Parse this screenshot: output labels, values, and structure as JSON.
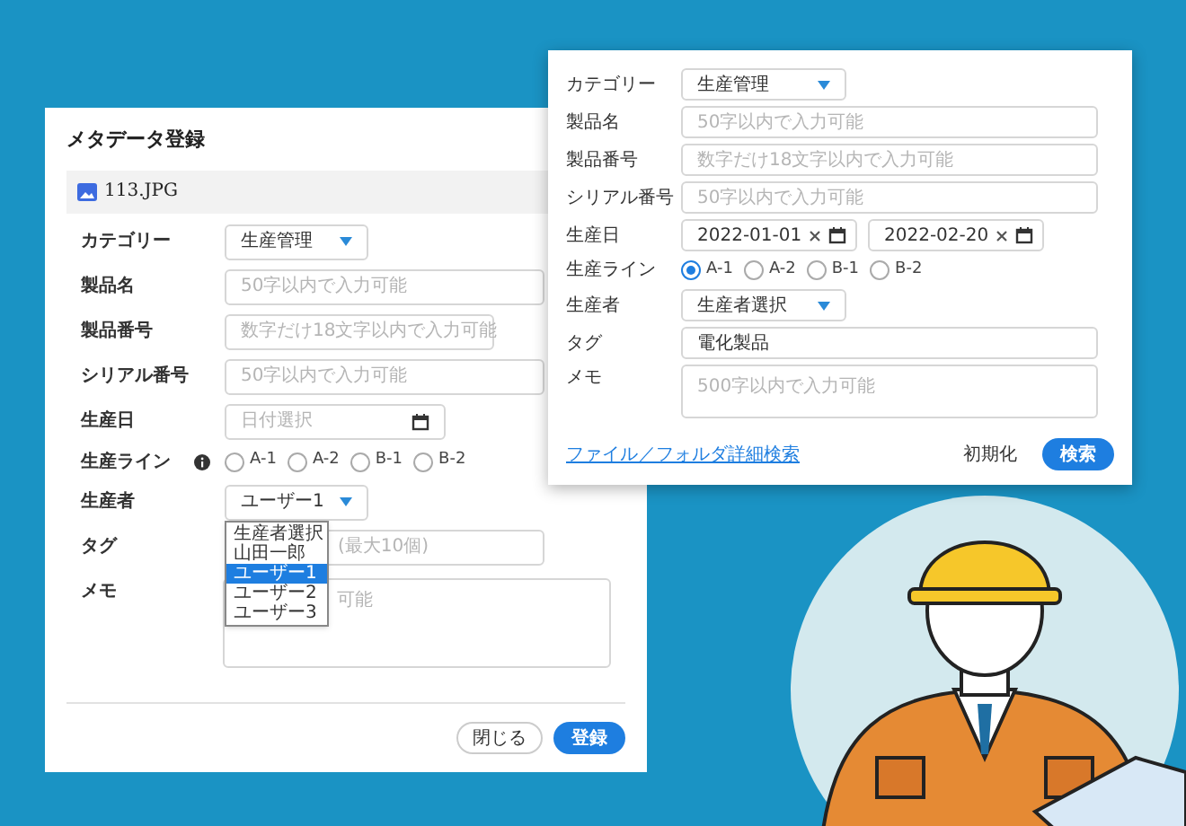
{
  "registration_dialog": {
    "title": "メタデータ登録",
    "file": "113.JPG",
    "fields": [
      {
        "kind": "select",
        "label": "カテゴリー",
        "value": "生産管理"
      },
      {
        "kind": "text",
        "label": "製品名",
        "placeholder": "50字以内で入力可能",
        "wide": true
      },
      {
        "kind": "text",
        "label": "製品番号",
        "placeholder": "数字だけ18文字以内で入力可能",
        "wide": false
      },
      {
        "kind": "text",
        "label": "シリアル番号",
        "placeholder": "50字以内で入力可能",
        "wide": true
      },
      {
        "kind": "date",
        "label": "生産日",
        "placeholder": "日付選択"
      },
      {
        "kind": "radio",
        "label": "生産ライン",
        "info": true,
        "options": [
          {
            "label": "A-1",
            "selected": false
          },
          {
            "label": "A-2",
            "selected": false
          },
          {
            "label": "B-1",
            "selected": false
          },
          {
            "label": "B-2",
            "selected": false
          }
        ]
      },
      {
        "kind": "select",
        "label": "生産者",
        "value": "ユーザー1",
        "dropdown": [
          {
            "label": "生産者選択",
            "selected": false
          },
          {
            "label": "山田一郎",
            "selected": false
          },
          {
            "label": "ユーザー1",
            "selected": true
          },
          {
            "label": "ユーザー2",
            "selected": false
          },
          {
            "label": "ユーザー3",
            "selected": false
          }
        ]
      },
      {
        "kind": "text",
        "label": "タグ",
        "placeholder": "(最大10個)",
        "wide": true
      },
      {
        "kind": "textarea",
        "label": "メモ",
        "placeholder": "可能"
      }
    ],
    "buttons": [
      {
        "label": "閉じる",
        "primary": false
      },
      {
        "label": "登録",
        "primary": true
      }
    ]
  },
  "search_panel": {
    "fields": [
      {
        "kind": "select",
        "label": "カテゴリー",
        "value": "生産管理"
      },
      {
        "kind": "text",
        "label": "製品名",
        "placeholder": "50字以内で入力可能"
      },
      {
        "kind": "text",
        "label": "製品番号",
        "placeholder": "数字だけ18文字以内で入力可能"
      },
      {
        "kind": "text",
        "label": "シリアル番号",
        "placeholder": "50字以内で入力可能"
      },
      {
        "kind": "daterange",
        "label": "生産日",
        "values": [
          "2022-01-01",
          "2022-02-20"
        ]
      },
      {
        "kind": "radio",
        "label": "生産ライン",
        "options": [
          {
            "label": "A-1",
            "selected": true
          },
          {
            "label": "A-2",
            "selected": false
          },
          {
            "label": "B-1",
            "selected": false
          },
          {
            "label": "B-2",
            "selected": false
          }
        ]
      },
      {
        "kind": "select",
        "label": "生産者",
        "value": "生産者選択"
      },
      {
        "kind": "text",
        "label": "タグ",
        "value": "電化製品"
      },
      {
        "kind": "textarea",
        "label": "メモ",
        "placeholder": "500字以内で入力可能"
      }
    ],
    "link": "ファイル／フォルダ詳細検索",
    "buttons": [
      {
        "label": "初期化",
        "primary": false
      },
      {
        "label": "検索",
        "primary": true
      }
    ]
  }
}
